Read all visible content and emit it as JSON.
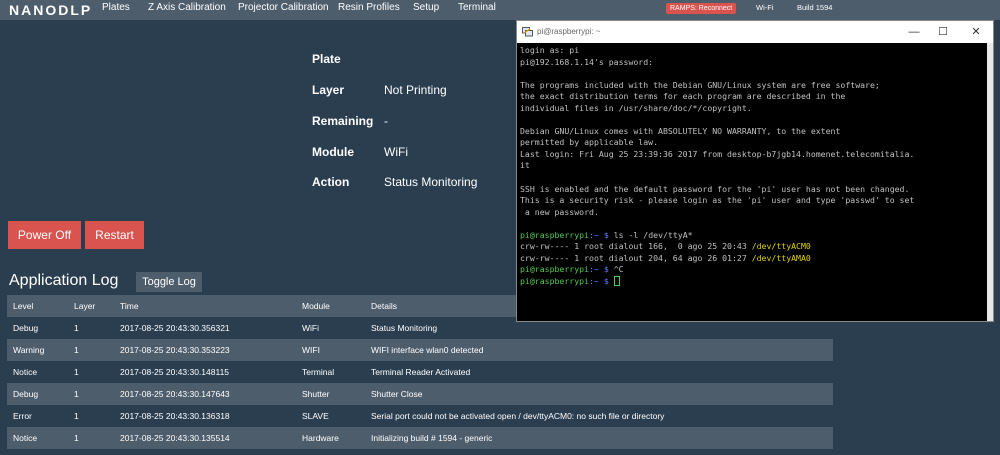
{
  "navbar": {
    "brand": "NANODLP",
    "items": [
      "Plates",
      "Z Axis Calibration",
      "Projector Calibration",
      "Resin Profiles",
      "Setup",
      "Terminal"
    ],
    "ramps_label": "RAMPS: Reconnect",
    "wifi_label": "Wi-Fi",
    "build_label": "Build 1594",
    "colors": {
      "navbar": "#4e5d6c",
      "danger": "#d9534f",
      "background": "#2b3e50"
    }
  },
  "status": {
    "plate_label": "Plate",
    "layer_label": "Layer",
    "layer_value": "Not Printing",
    "remaining_label": "Remaining",
    "remaining_value": "-",
    "module_label": "Module",
    "module_value": "WiFi",
    "action_label": "Action",
    "action_value": "Status Monitoring"
  },
  "buttons": {
    "power_off": "Power Off",
    "restart": "Restart",
    "toggle_log": "Toggle Log"
  },
  "log": {
    "title": "Application Log",
    "columns": [
      "Level",
      "Layer",
      "Time",
      "Module",
      "Details"
    ],
    "rows": [
      [
        "Debug",
        "1",
        "2017-08-25 20:43:30.356321",
        "WiFi",
        "Status Monitoring"
      ],
      [
        "Warning",
        "1",
        "2017-08-25 20:43:30.353223",
        "WIFI",
        "WIFI interface wlan0 detected"
      ],
      [
        "Notice",
        "1",
        "2017-08-25 20:43:30.148115",
        "Terminal",
        "Terminal Reader Activated"
      ],
      [
        "Debug",
        "1",
        "2017-08-25 20:43:30.147643",
        "Shutter",
        "Shutter Close"
      ],
      [
        "Error",
        "1",
        "2017-08-25 20:43:30.136318",
        "SLAVE",
        "Serial port could not be activated open / dev/ttyACM0: no such file or directory"
      ],
      [
        "Notice",
        "1",
        "2017-08-25 20:43:30.135514",
        "Hardware",
        "Initializing build # 1594 - generic"
      ]
    ]
  },
  "terminal": {
    "title": "pi@raspberrypi: ~",
    "icon": "putty-icon",
    "controls": {
      "minimize": "—",
      "maximize": "☐",
      "close": "✕"
    },
    "lines": [
      "login as: pi",
      "pi@192.168.1.14's password:",
      "",
      "The programs included with the Debian GNU/Linux system are free software;",
      "the exact distribution terms for each program are described in the",
      "individual files in /usr/share/doc/*/copyright.",
      "",
      "Debian GNU/Linux comes with ABSOLUTELY NO WARRANTY, to the extent",
      "permitted by applicable law.",
      "Last login: Fri Aug 25 23:39:36 2017 from desktop-b7jgb14.homenet.telecomitalia.",
      "it",
      "",
      "SSH is enabled and the default password for the 'pi' user has not been changed.",
      "This is a security risk - please login as the 'pi' user and type 'passwd' to set",
      " a new password.",
      ""
    ],
    "prompt_user": "pi@raspberrypi",
    "prompt_path": "~",
    "prompt_symbol": "$",
    "cmd1": "ls -l /dev/ttyA*",
    "out1_text": "crw-rw---- 1 root dialout 166,  0 ago 25 20:43 ",
    "out1_dev": "/dev/ttyACM0",
    "out2_text": "crw-rw---- 1 root dialout 204, 64 ago 26 01:27 ",
    "out2_dev": "/dev/ttyAMA0",
    "cmd2": "^C"
  }
}
